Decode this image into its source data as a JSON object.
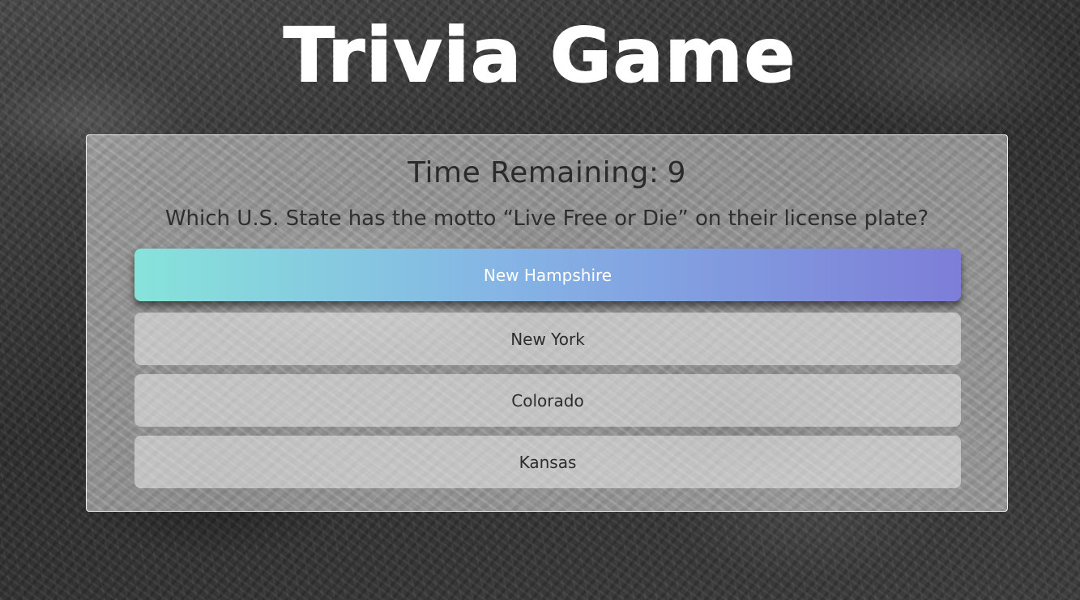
{
  "header": {
    "title": "Trivia Game"
  },
  "game": {
    "timer_label": "Time Remaining:",
    "timer_value": "9",
    "question": "Which U.S. State has the motto “Live Free or Die” on their license plate?",
    "answers": [
      {
        "label": "New Hampshire",
        "selected": true
      },
      {
        "label": "New York",
        "selected": false
      },
      {
        "label": "Colorado",
        "selected": false
      },
      {
        "label": "Kansas",
        "selected": false
      }
    ]
  },
  "colors": {
    "selected_gradient_start": "#86e3da",
    "selected_gradient_end": "#7d7ed8",
    "title": "#ffffff"
  }
}
